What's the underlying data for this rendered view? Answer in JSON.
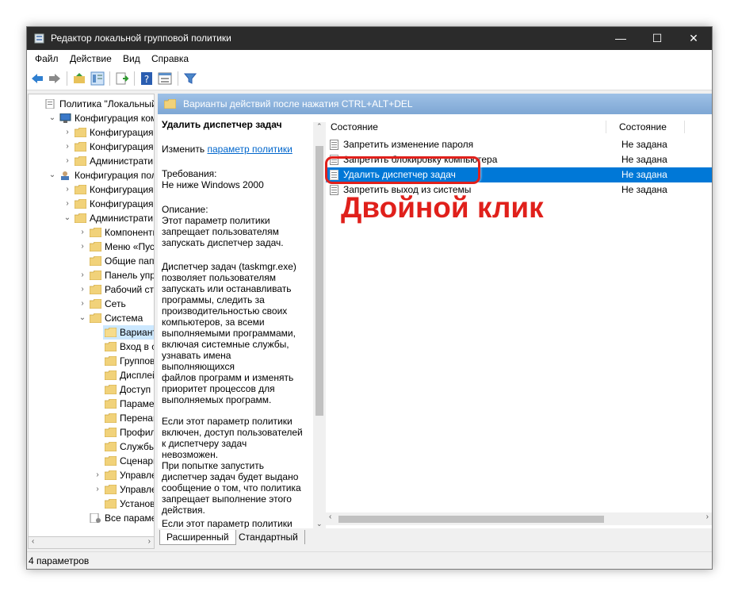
{
  "window": {
    "title": "Редактор локальной групповой политики",
    "minimize": "—",
    "maximize": "☐",
    "close": "✕"
  },
  "menu": [
    "Файл",
    "Действие",
    "Вид",
    "Справка"
  ],
  "tree": [
    {
      "label": "Политика \"Локальный к"
    },
    {
      "label": "Конфигурация компь"
    },
    {
      "label": "Конфигурация пр"
    },
    {
      "label": "Конфигурация W"
    },
    {
      "label": "Административн"
    },
    {
      "label": "Конфигурация поль"
    },
    {
      "label": "Конфигурация пр"
    },
    {
      "label": "Конфигурация W"
    },
    {
      "label": "Административн"
    },
    {
      "label": "Компоненты"
    },
    {
      "label": "Меню «Пуск»"
    },
    {
      "label": "Общие папки"
    },
    {
      "label": "Панель управ"
    },
    {
      "label": "Рабочий стол"
    },
    {
      "label": "Сеть"
    },
    {
      "label": "Система"
    },
    {
      "label": "Варианты"
    },
    {
      "label": "Вход в сис"
    },
    {
      "label": "Групповая"
    },
    {
      "label": "Дисплей"
    },
    {
      "label": "Доступ к с"
    },
    {
      "label": "Параметр"
    },
    {
      "label": "Перенапр"
    },
    {
      "label": "Профили"
    },
    {
      "label": "Службы я"
    },
    {
      "label": "Сценарии"
    },
    {
      "label": "Управлен"
    },
    {
      "label": "Управлен"
    },
    {
      "label": "Установка"
    },
    {
      "label": "Все параметр"
    }
  ],
  "header": {
    "title": "Варианты действий после нажатия CTRL+ALT+DEL"
  },
  "description": {
    "title": "Удалить диспетчер задач",
    "edit_prefix": "Изменить",
    "edit_link": "параметр политики",
    "req_label": "Требования:",
    "req_value": "Не ниже Windows 2000",
    "desc_label": "Описание:",
    "p1": [
      "Этот параметр политики",
      "запрещает пользователям",
      "запускать диспетчер задач."
    ],
    "p2": [
      "Диспетчер задач (taskmgr.exe)",
      "позволяет пользователям",
      "запускать или останавливать",
      "программы, следить за",
      "производительностью своих",
      "компьютеров, за всеми",
      "выполняемыми программами,",
      "включая системные службы,",
      "узнавать имена выполняющихся",
      "файлов программ и изменять",
      "приоритет процессов для",
      "выполняемых программ."
    ],
    "p3": [
      "Если этот параметр политики",
      "включен, доступ пользователей",
      "к диспетчеру задач невозможен.",
      "При попытке запустить",
      "диспетчер задач будет выдано",
      "сообщение о том, что политика",
      "запрещает выполнение этого",
      "действия."
    ],
    "p4": "Если этот параметр политики"
  },
  "columns": {
    "name": "Состояние",
    "state": "Состояние"
  },
  "rows": [
    {
      "name": "Запретить изменение пароля",
      "state": "Не задана"
    },
    {
      "name": "Запретить блокировку компьютера",
      "state": "Не задана"
    },
    {
      "name": "Удалить диспетчер задач",
      "state": "Не задана"
    },
    {
      "name": "Запретить выход из системы",
      "state": "Не задана"
    }
  ],
  "tabs": [
    "Расширенный",
    "Стандартный"
  ],
  "status": "4 параметров",
  "annotation": "Двойной клик",
  "colors": {
    "selection": "#0078d7",
    "titlebar": "#2b2b2b",
    "annotation": "#e0201b",
    "header": "#7ea7d4"
  }
}
